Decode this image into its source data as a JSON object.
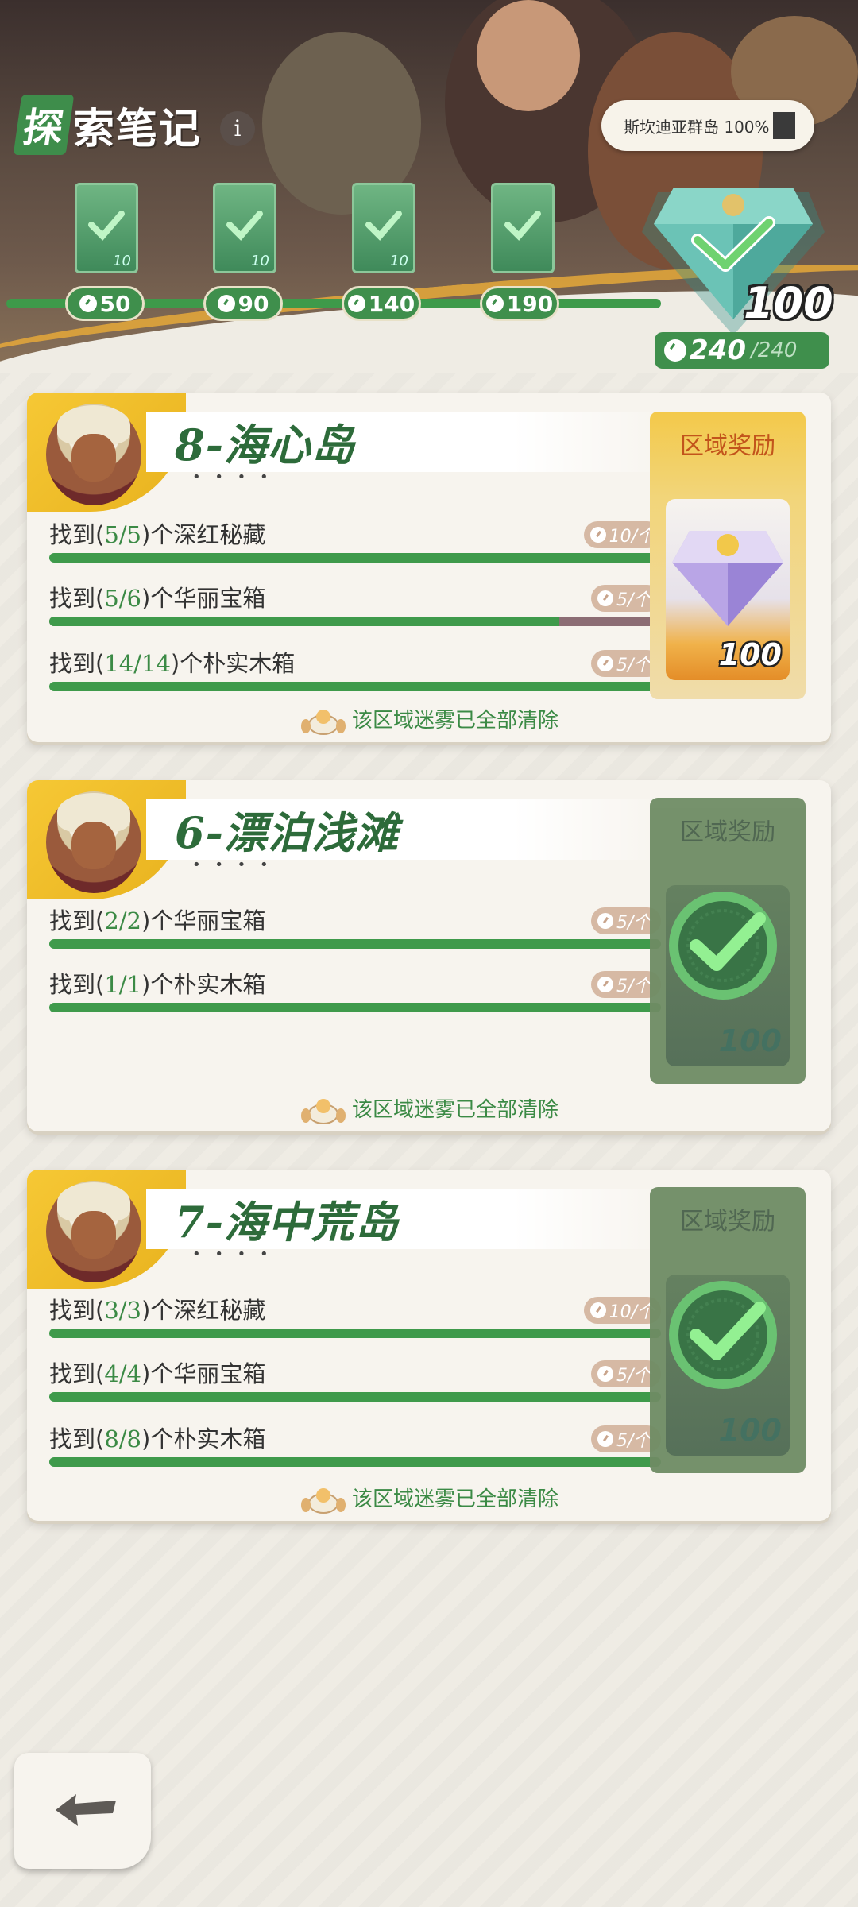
{
  "header": {
    "title_first": "探",
    "title_rest": "索笔记",
    "info_icon": "i",
    "region_progress": "斯坎迪亚群岛 100%",
    "milestones": [
      {
        "value": "50",
        "card_num": "10",
        "claimed": true
      },
      {
        "value": "90",
        "card_num": "10",
        "claimed": true
      },
      {
        "value": "140",
        "card_num": "10",
        "claimed": true
      },
      {
        "value": "190",
        "card_num": "",
        "claimed": true
      }
    ],
    "final_reward_amount": "100",
    "total_current": "240",
    "total_max": "/240"
  },
  "cards": [
    {
      "name": "8-海心岛",
      "dots": "• • • •",
      "tasks": [
        {
          "prefix": "找到(",
          "count": "5/5",
          "suffix": ")个深红秘藏",
          "reward": "10/个",
          "progress": 1.0
        },
        {
          "prefix": "找到(",
          "count": "5/6",
          "suffix": ")个华丽宝箱",
          "reward": "5/个",
          "progress": 0.8333
        },
        {
          "prefix": "找到(",
          "count": "14/14",
          "suffix": ")个朴实木箱",
          "reward": "5/个",
          "progress": 1.0
        }
      ],
      "clear_text": "该区域迷雾已全部清除",
      "reward_label": "区域奖励",
      "reward_amount": "100",
      "reward_claimed": false
    },
    {
      "name": "6-漂泊浅滩",
      "dots": "• • • •",
      "tasks": [
        {
          "prefix": "找到(",
          "count": "2/2",
          "suffix": ")个华丽宝箱",
          "reward": "5/个",
          "progress": 1.0
        },
        {
          "prefix": "找到(",
          "count": "1/1",
          "suffix": ")个朴实木箱",
          "reward": "5/个",
          "progress": 1.0
        }
      ],
      "clear_text": "该区域迷雾已全部清除",
      "reward_label": "区域奖励",
      "reward_amount": "100",
      "reward_claimed": true
    },
    {
      "name": "7-海中荒岛",
      "dots": "• • • •",
      "tasks": [
        {
          "prefix": "找到(",
          "count": "3/3",
          "suffix": ")个深红秘藏",
          "reward": "10/个",
          "progress": 1.0
        },
        {
          "prefix": "找到(",
          "count": "4/4",
          "suffix": ")个华丽宝箱",
          "reward": "5/个",
          "progress": 1.0
        },
        {
          "prefix": "找到(",
          "count": "8/8",
          "suffix": ")个朴实木箱",
          "reward": "5/个",
          "progress": 1.0
        }
      ],
      "clear_text": "该区域迷雾已全部清除",
      "reward_label": "区域奖励",
      "reward_amount": "100",
      "reward_claimed": true
    }
  ],
  "colors": {
    "accent_green": "#3f9a4b",
    "gold": "#f6c835",
    "bar_remaining": "#8c6d74"
  },
  "icons": {
    "back": "back-arrow-icon",
    "timer": "stopwatch-icon",
    "check": "check-icon",
    "gem": "diamond-icon"
  }
}
